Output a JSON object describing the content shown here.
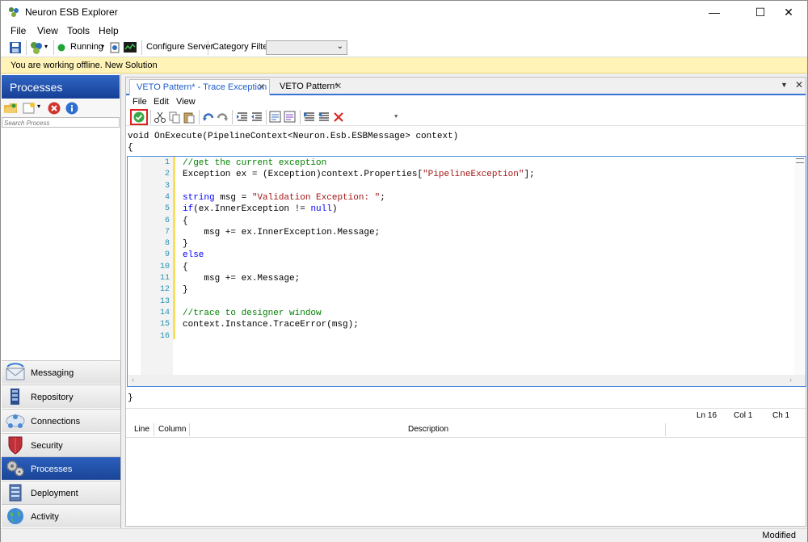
{
  "window": {
    "title": "Neuron ESB Explorer",
    "minimize": "—",
    "maximize": "☐",
    "close": "✕"
  },
  "menu": [
    "File",
    "View",
    "Tools",
    "Help"
  ],
  "toolbar": {
    "running_label": "Running",
    "configure_server": "Configure Server",
    "category_filter_label": "Category Filter",
    "category_filter_value": ""
  },
  "notice": "You are working offline. New Solution",
  "left_pane": {
    "title": "Processes",
    "search_placeholder": "Search Process",
    "nav": [
      {
        "label": "Messaging",
        "icon": "envelope-icon",
        "active": false
      },
      {
        "label": "Repository",
        "icon": "repository-icon",
        "active": false
      },
      {
        "label": "Connections",
        "icon": "cloud-connections-icon",
        "active": false
      },
      {
        "label": "Security",
        "icon": "shield-icon",
        "active": false
      },
      {
        "label": "Processes",
        "icon": "gears-icon",
        "active": true
      },
      {
        "label": "Deployment",
        "icon": "server-icon",
        "active": false
      },
      {
        "label": "Activity",
        "icon": "globe-icon",
        "active": false
      }
    ]
  },
  "tabs": [
    {
      "label": "VETO Pattern* - Trace Exception",
      "active": true
    },
    {
      "label": "VETO Pattern*",
      "active": false
    }
  ],
  "editor_menu": [
    "File",
    "Edit",
    "View"
  ],
  "signature": "void OnExecute(PipelineContext<Neuron.Esb.ESBMessage> context)",
  "open_brace": "{",
  "close_brace": "}",
  "code_lines": [
    "//get the current exception",
    "Exception ex = (Exception)context.Properties[\"PipelineException\"];",
    "",
    "string msg = \"Validation Exception: \";",
    "if(ex.InnerException != null)",
    "{",
    "    msg += ex.InnerException.Message;",
    "}",
    "else",
    "{",
    "    msg += ex.Message;",
    "}",
    "",
    "//trace to designer window",
    "context.Instance.TraceError(msg);",
    ""
  ],
  "cursor": {
    "ln": "Ln 16",
    "col": "Col 1",
    "ch": "Ch 1"
  },
  "error_columns": [
    "Line",
    "Column",
    "Description"
  ],
  "status": "Modified",
  "colors": {
    "accent": "#3874d8",
    "keyword": "#0000ff",
    "comment": "#008000",
    "string": "#a31515",
    "line_number": "#2b91af",
    "notice_bg": "#fff3b8"
  }
}
